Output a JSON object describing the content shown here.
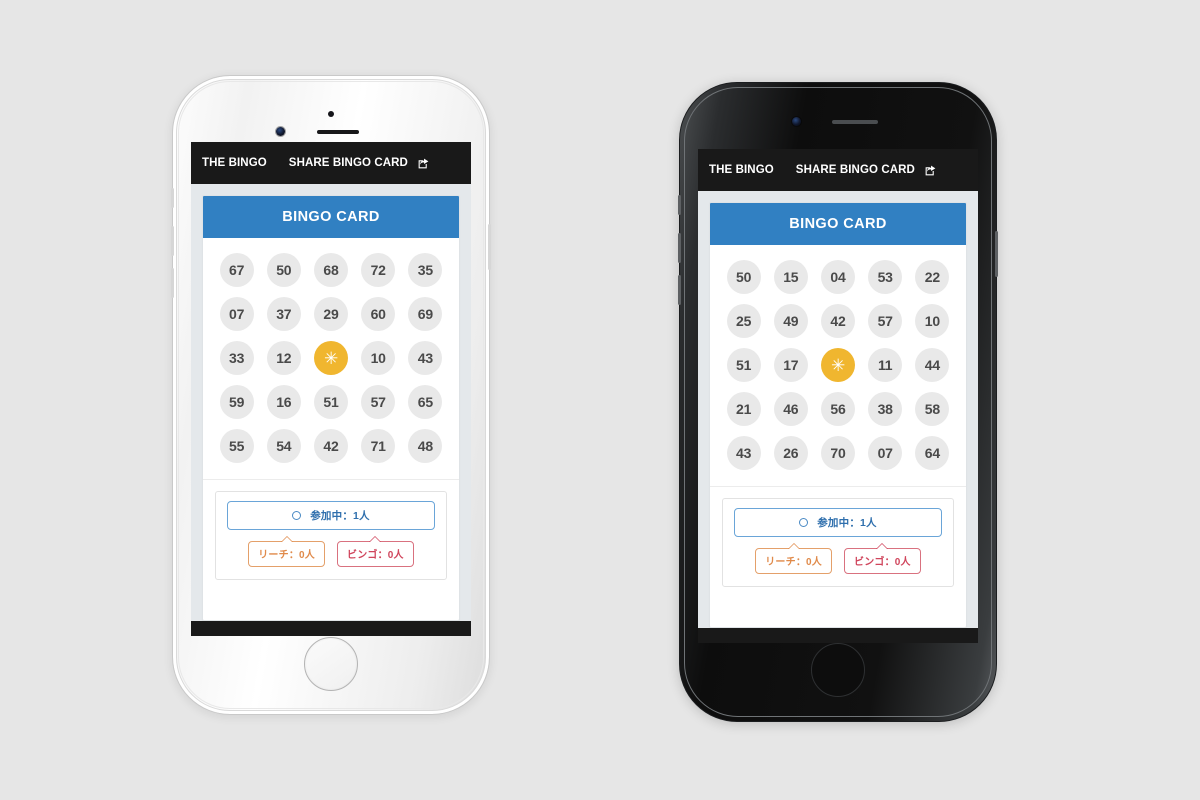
{
  "meta": {
    "canvas_background": "#e6e6e6",
    "accent_blue": "#3180c2",
    "accent_amber": "#f0b62f",
    "navbar_black": "#191919",
    "page_background": "#e4e8eb"
  },
  "navbar": {
    "brand": "THE BINGO",
    "share_link": "SHARE BINGO CARD",
    "share_icon": "share-square-icon"
  },
  "card": {
    "header_title": "BINGO CARD"
  },
  "status": {
    "spinner_icon": "circle-spinner-icon",
    "joined_label": "参加中：1人",
    "reach_label": "リーチ：0人",
    "bingo_label": "ビンゴ：0人"
  },
  "phones": [
    {
      "id": "phone-white",
      "color_name": "silver",
      "grid": {
        "free_index": 12,
        "free_glyph": "✳",
        "cells": [
          "67",
          "50",
          "68",
          "72",
          "35",
          "07",
          "37",
          "29",
          "60",
          "69",
          "33",
          "12",
          "FREE",
          "10",
          "43",
          "59",
          "16",
          "51",
          "57",
          "65",
          "55",
          "54",
          "42",
          "71",
          "48"
        ]
      }
    },
    {
      "id": "phone-black",
      "color_name": "space-gray",
      "grid": {
        "free_index": 12,
        "free_glyph": "✳",
        "cells": [
          "50",
          "15",
          "04",
          "53",
          "22",
          "25",
          "49",
          "42",
          "57",
          "10",
          "51",
          "17",
          "FREE",
          "11",
          "44",
          "21",
          "46",
          "56",
          "38",
          "58",
          "43",
          "26",
          "70",
          "07",
          "64"
        ]
      }
    }
  ]
}
